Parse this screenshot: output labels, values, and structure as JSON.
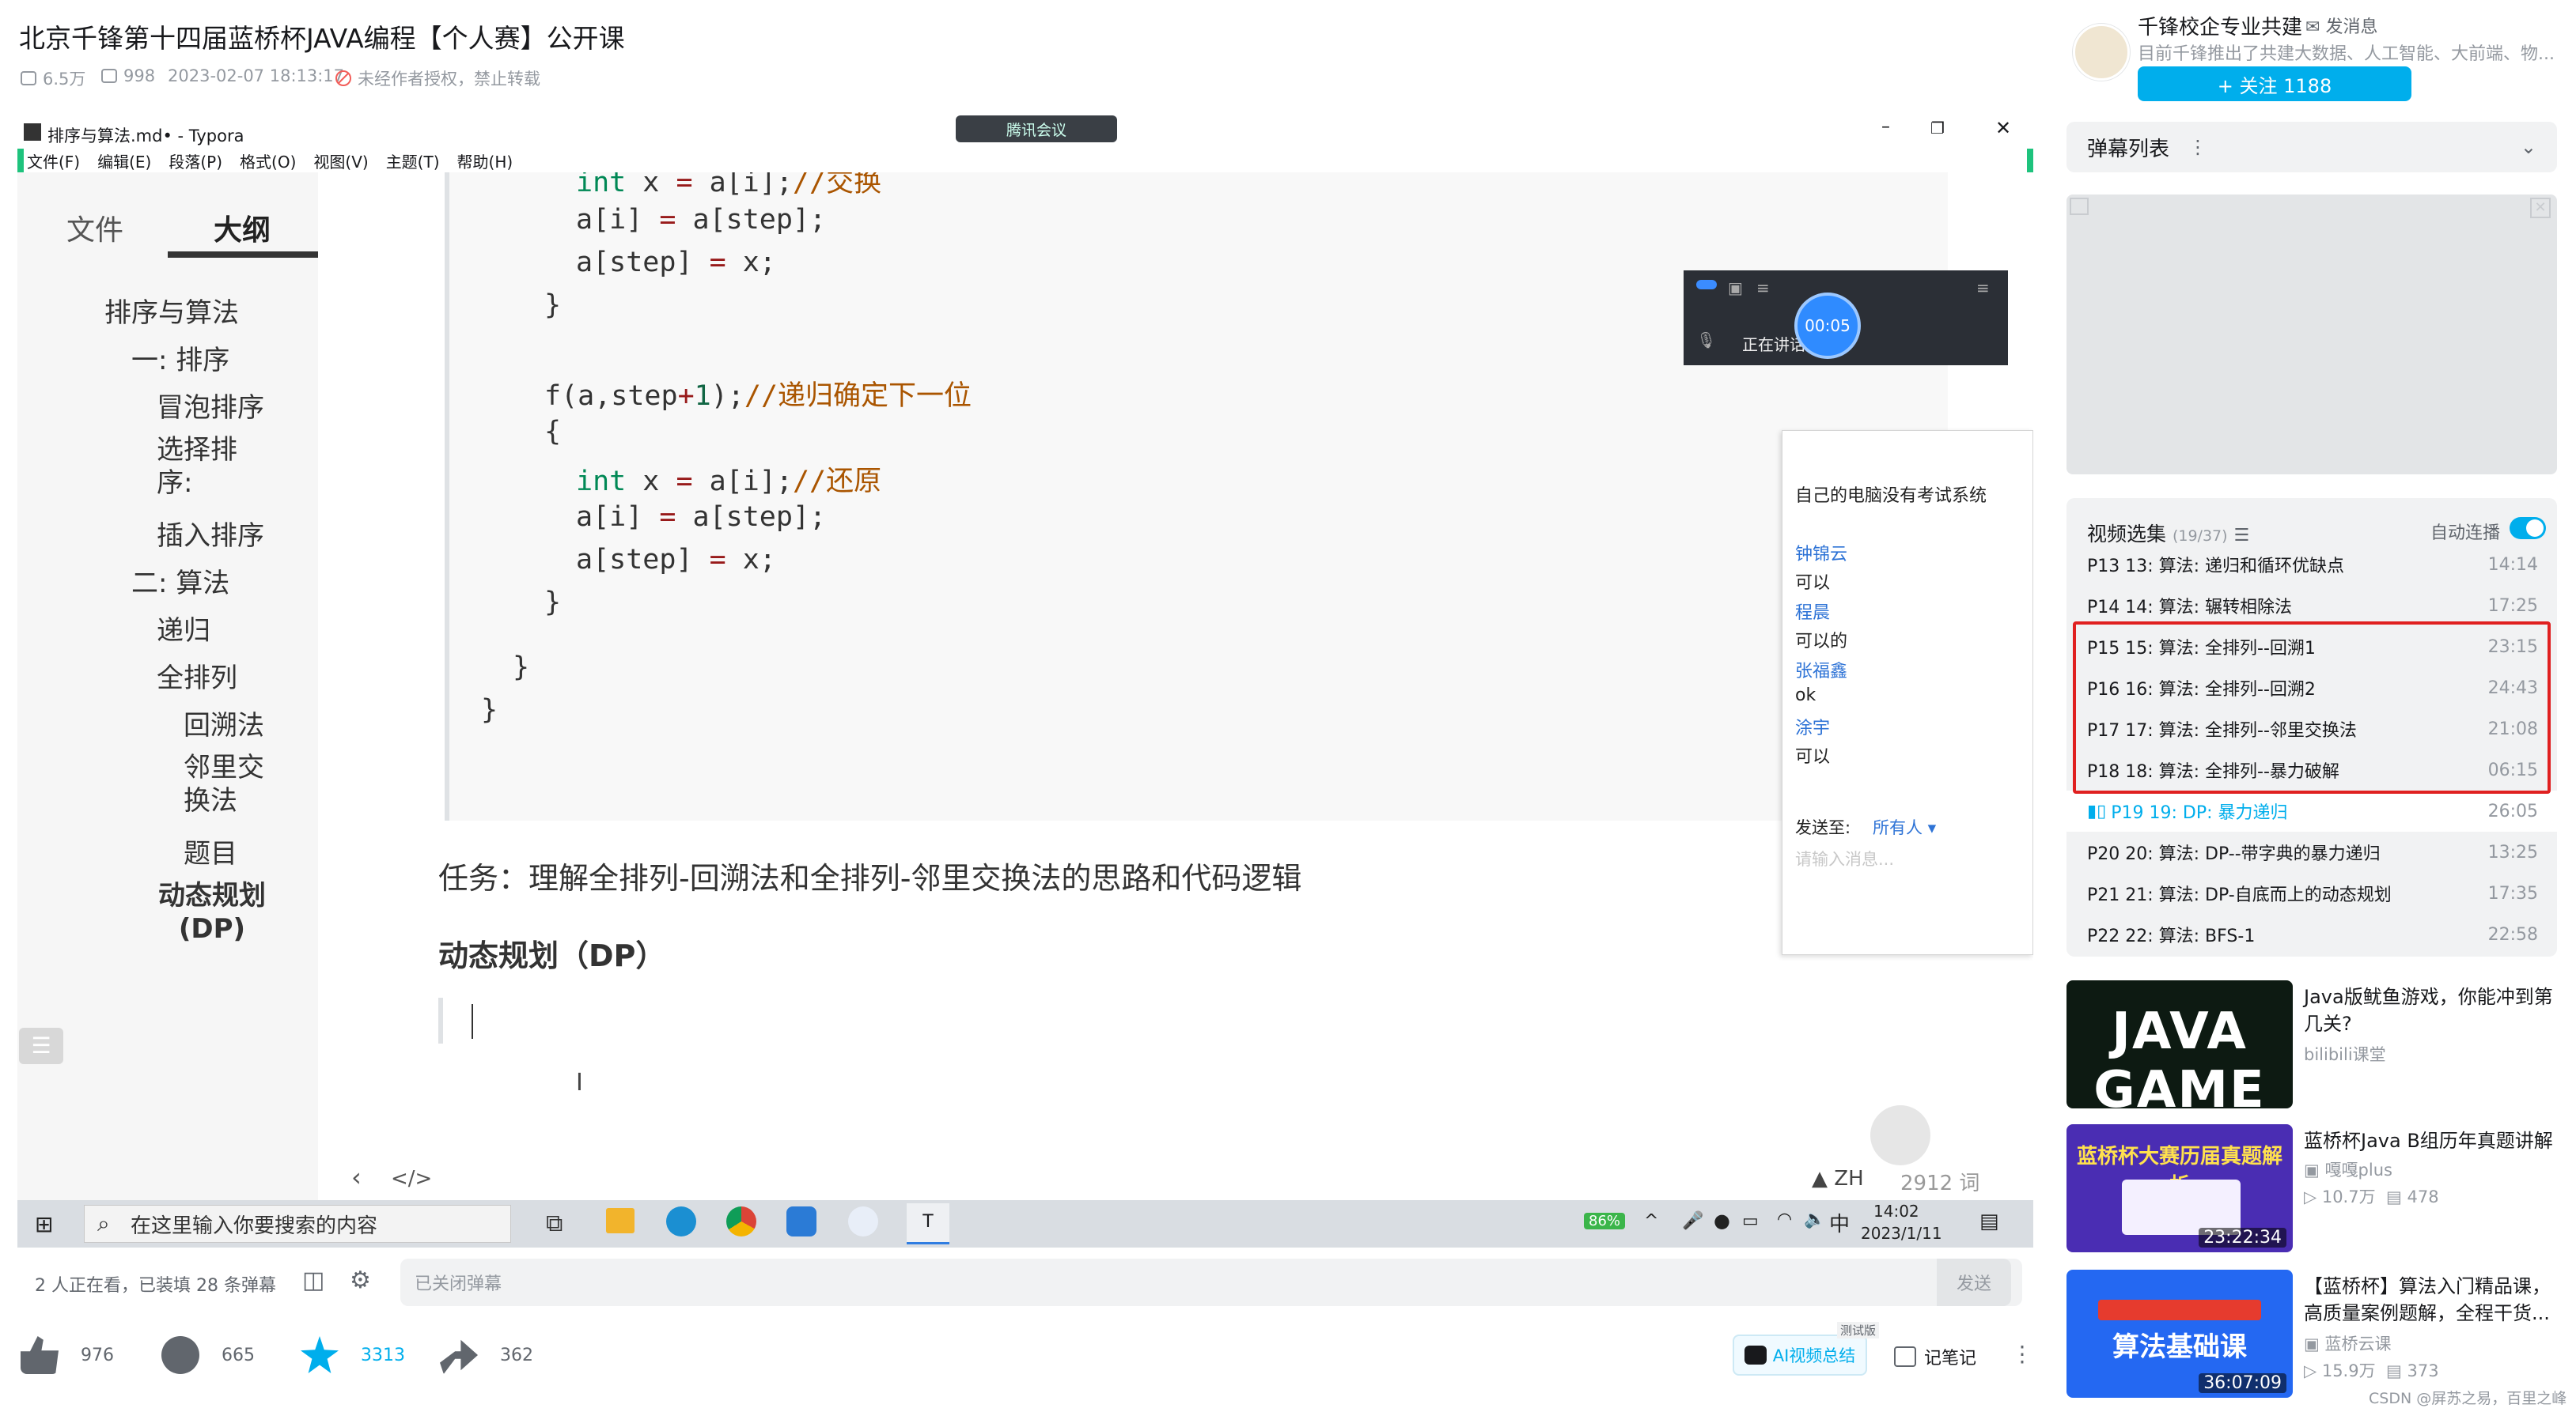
{
  "header": {
    "title": "北京千锋第十四届蓝桥杯JAVA编程【个人赛】公开课",
    "views": "6.5万",
    "danmaku_count": "998",
    "datetime": "2023-02-07 18:13:17",
    "copyright": "未经作者授权，禁止转载"
  },
  "typora": {
    "window_title": "排序与算法.md• - Typora",
    "meeting_tab": "腾讯会议",
    "menu": [
      "文件(F)",
      "编辑(E)",
      "段落(P)",
      "格式(O)",
      "视图(V)",
      "主题(T)",
      "帮助(H)"
    ],
    "sidebar_tabs": [
      "文件",
      "大纲"
    ],
    "outline": [
      {
        "label": "排序与算法",
        "level": 1
      },
      {
        "label": "一: 排序",
        "level": 2
      },
      {
        "label": "冒泡排序",
        "level": 3
      },
      {
        "label": "选择排序:",
        "level": 3
      },
      {
        "label": "插入排序",
        "level": 3
      },
      {
        "label": "二: 算法",
        "level": 2
      },
      {
        "label": "递归",
        "level": 3
      },
      {
        "label": "全排列",
        "level": 3
      },
      {
        "label": "回溯法",
        "level": 4
      },
      {
        "label": "邻里交换法",
        "level": 4
      },
      {
        "label": "题目",
        "level": 4
      },
      {
        "label": "动态规划(DP)",
        "level": 3
      }
    ],
    "code_lines": [
      "        int x = a[i];//交换",
      "        a[i] = a[step];",
      "        a[step] = x;",
      "    }",
      "",
      "    f(a,step+1);//递归确定下一位",
      "    {",
      "        int x = a[i];//还原",
      "        a[i] = a[step];",
      "        a[step] = x;",
      "    }",
      "  }",
      "}"
    ],
    "task_text": "任务：理解全排列-回溯法和全排列-邻里交换法的思路和代码逻辑",
    "heading_dp": "动态规划（DP）",
    "status_lang": "ZH",
    "word_count": "2912 词"
  },
  "meeting": {
    "timer": "00:05",
    "speaking": "正在讲话"
  },
  "chat": {
    "first_msg": "自己的电脑没有考试系统",
    "messages": [
      {
        "name": "钟锦云",
        "text": "可以"
      },
      {
        "name": "程晨",
        "text": "可以的"
      },
      {
        "name": "张福鑫",
        "text": "ok"
      },
      {
        "name": "涂宇",
        "text": "可以"
      }
    ],
    "send_to_label": "发送至:",
    "send_to_value": "所有人",
    "input_placeholder": "请输入消息..."
  },
  "taskbar": {
    "search_placeholder": "在这里输入你要搜索的内容",
    "battery": "86%",
    "ime": "中",
    "time": "14:02",
    "date": "2023/1/11"
  },
  "danmaku_bar": {
    "viewers": "2 人正在看，已装填 28 条弹幕",
    "input_placeholder": "已关闭弹幕",
    "send": "发送"
  },
  "actions": {
    "likes": "976",
    "coins": "665",
    "favorites": "3313",
    "shares": "362",
    "ai_summary": "AI视频总结",
    "ai_badge": "测试版",
    "notes": "记笔记"
  },
  "uploader": {
    "name": "千锋校企专业共建",
    "message": "发消息",
    "description": "目前千锋推出了共建大数据、人工智能、大前端、物...",
    "follow": "+ 关注 1188"
  },
  "danmaku_list": {
    "title": "弹幕列表"
  },
  "playlist": {
    "title": "视频选集",
    "count": "(19/37)",
    "autoplay": "自动连播",
    "items": [
      {
        "label": "P13  13:  算法:  递归和循环优缺点",
        "duration": "14:14",
        "active": false
      },
      {
        "label": "P14  14:  算法:  辗转相除法",
        "duration": "17:25",
        "active": false
      },
      {
        "label": "P15  15:  算法:  全排列--回溯1",
        "duration": "23:15",
        "active": false
      },
      {
        "label": "P16  16:  算法:  全排列--回溯2",
        "duration": "24:43",
        "active": false
      },
      {
        "label": "P17  17:  算法:  全排列--邻里交换法",
        "duration": "21:08",
        "active": false
      },
      {
        "label": "P18  18:  算法:  全排列--暴力破解",
        "duration": "06:15",
        "active": false
      },
      {
        "label": "P19  19:  DP:  暴力递归",
        "duration": "26:05",
        "active": true
      },
      {
        "label": "P20  20:  算法:  DP--带字典的暴力递归",
        "duration": "13:25",
        "active": false
      },
      {
        "label": "P21  21:  算法:  DP-自底而上的动态规划",
        "duration": "17:35",
        "active": false
      },
      {
        "label": "P22  22:  算法:  BFS-1",
        "duration": "22:58",
        "active": false
      }
    ]
  },
  "recommendations": [
    {
      "title": "Java版鱿鱼游戏，你能冲到第几关?",
      "up": "bilibili课堂",
      "views": "",
      "danmaku": "",
      "duration": "",
      "thumb_text": "JAVA GAME"
    },
    {
      "title": "蓝桥杯Java B组历年真题讲解",
      "up": "嘎嘎plus",
      "views": "10.7万",
      "danmaku": "478",
      "duration": "23:22:34",
      "thumb_text": "蓝桥杯大赛历届真题解析"
    },
    {
      "title": "【蓝桥杯】算法入门精品课，高质量案例题解，全程干货...",
      "up": "蓝桥云课",
      "views": "15.9万",
      "danmaku": "373",
      "duration": "36:07:09",
      "thumb_text": "算法基础课"
    }
  ],
  "watermark": "CSDN @屏苏之易，百里之峰",
  "colors": {
    "accent": "#00aeec",
    "highlight_box": "#e02020",
    "green_frame": "#1ec37d"
  }
}
